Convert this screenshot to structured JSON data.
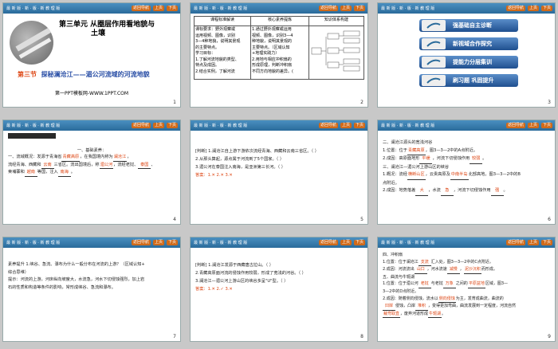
{
  "header": {
    "logo": "最 新 版 · 新 · 版 · 新 教 理 版",
    "nav": [
      "返回导航",
      "上页",
      "下页"
    ]
  },
  "slide1": {
    "number": "1",
    "unit_title": "第三单元  从圈层作用看地貌与",
    "unit_title2": "土壤",
    "section_prefix": "第三节",
    "section_title": "探秘澜沧江——湄公河流域的河流地貌",
    "footer": "第一PPT模板网-WWW.1PPT.COM"
  },
  "slide2": {
    "number": "2",
    "headers": [
      "课程标准解读",
      "核心素养提炼",
      "知识体系构建"
    ],
    "col1": [
      "课标要求：野外观察或",
      "运用视频、图像，识别",
      "3—4种地貌，说明其景观",
      "的主要特点。",
      "学习目标：",
      "1.了解河流地貌的类型、",
      "特点及成因。",
      "2.结合实例，了解河流"
    ],
    "col2": [
      "1.通过野外观察或运用",
      "视频、图像，识别3—4",
      "种地貌，说明其景观的",
      "主要特点。（区域认知",
      "+地理实践力）",
      "2.用地与相应冲积扇的",
      "形成原理，判断冲积扇",
      "不同方向地貌的差异。("
    ]
  },
  "slide3": {
    "number": "3",
    "items": [
      "强基础自主诊断",
      "新视域合作探究",
      "提能力分层集训",
      "刷习题 巩固提升"
    ]
  },
  "slide4": {
    "number": "4",
    "badge": "强基础",
    "badge_sub": "自主诊断",
    "heading": "一、基础素养：",
    "lines": [
      [
        "一、流域概况：发源于青海省",
        "青藏高原",
        "，在我国境内称为",
        "澜沧江",
        "，"
      ],
      [
        "流经青海、西藏和",
        "云南",
        "三省区。流出国境后，称",
        "湄公河",
        "，流经老挝、",
        "泰国",
        "、"
      ],
      [
        "柬埔寨和",
        "越南",
        "等国，注入",
        "南海",
        "。"
      ]
    ]
  },
  "slide5": {
    "number": "5",
    "lines": [
      "[判断] 1.澜沧江自上游下游依次流经青海、西藏和云南三省区。（    ）",
      "2.从那头算起，源点属于河流到了5个国家。（    ）",
      "3.湄公河在泰国注入南海，是亚洲第三长河。（    ）"
    ],
    "answer_label": "答案：",
    "answer": "1.✕  2.✕  3.✕"
  },
  "slide6": {
    "number": "6",
    "lines": [
      [
        "二、澜沧江源头的宽浅河谷"
      ],
      [
        "1.位置：位于",
        "青藏高原",
        "，图3—3—2中的A点附近。"
      ],
      [
        "2.成因：高原面地形",
        "平缓",
        "，河流下切侵蚀作用",
        "较弱",
        "。"
      ],
      [
        "三、澜沧江—湄公河上游山区的峡谷"
      ],
      [
        "1.概况：流经",
        "横断山区",
        "，云贵高原及",
        "中南半岛",
        "北部高地。图3—3—2中的B"
      ],
      [
        "点附近。"
      ],
      [
        "2.成因：地势落差",
        "大",
        "，水流",
        "急",
        "，河流下切侵蚀作用",
        "强",
        "。"
      ]
    ]
  },
  "slide7": {
    "number": "7",
    "lines": [
      "素养提升  1.峡谷、急流、瀑布为什么一般分布在河流的上游？（区域认知+",
      "综合思维）",
      "提示：河流的上游，河床纵向坡度大，水流急，河水下切侵蚀强烈，加上岩",
      "石的性质和构造等条件的影响，常形成峡谷、急流和瀑布。"
    ]
  },
  "slide8": {
    "number": "8",
    "lines": [
      "[判断] 1.澜沧江发源于西藏唐古拉山。（    ）",
      "2.青藏高原面河流的侵蚀作用较弱，形成了宽浅的河谷。（    ）",
      "3.澜沧江—湄公河上游山区的峡谷多呈\"U\"型。（    ）"
    ],
    "answer_label": "答案：",
    "answer": "1.✕  2.✓  3.✕"
  },
  "slide9": {
    "number": "9",
    "lines": [
      [
        "四、冲积扇"
      ],
      [
        "1.位置：位于澜沧江",
        "支流",
        "汇入处，图3—3—2中的C点附近。"
      ],
      [
        "2.成因：河流流出",
        "山口",
        "，河水流速",
        "减慢",
        "，",
        "泥沙沉积",
        "而形成。"
      ],
      [
        "五、曲流与牛轭湖"
      ],
      [
        "1.位置：位于湄公河",
        "老挝",
        "与老挝",
        "万象",
        "之间的",
        "平原盆地",
        "区域，图3—"
      ],
      [
        "3—2中的D点附近。"
      ],
      [
        "2.成因：随着侧向侵蚀，流水以",
        "侧向侵蚀",
        "为主，发育成曲流，曲流的"
      ],
      [
        "凹岸",
        "侵蚀，凸岸",
        "堆积",
        "，变得更加弯曲，曲流发展到一定程度，河流自然"
      ],
      [
        "裁弯取直",
        "，废弃河道形成",
        "牛轭湖",
        "。"
      ]
    ]
  }
}
